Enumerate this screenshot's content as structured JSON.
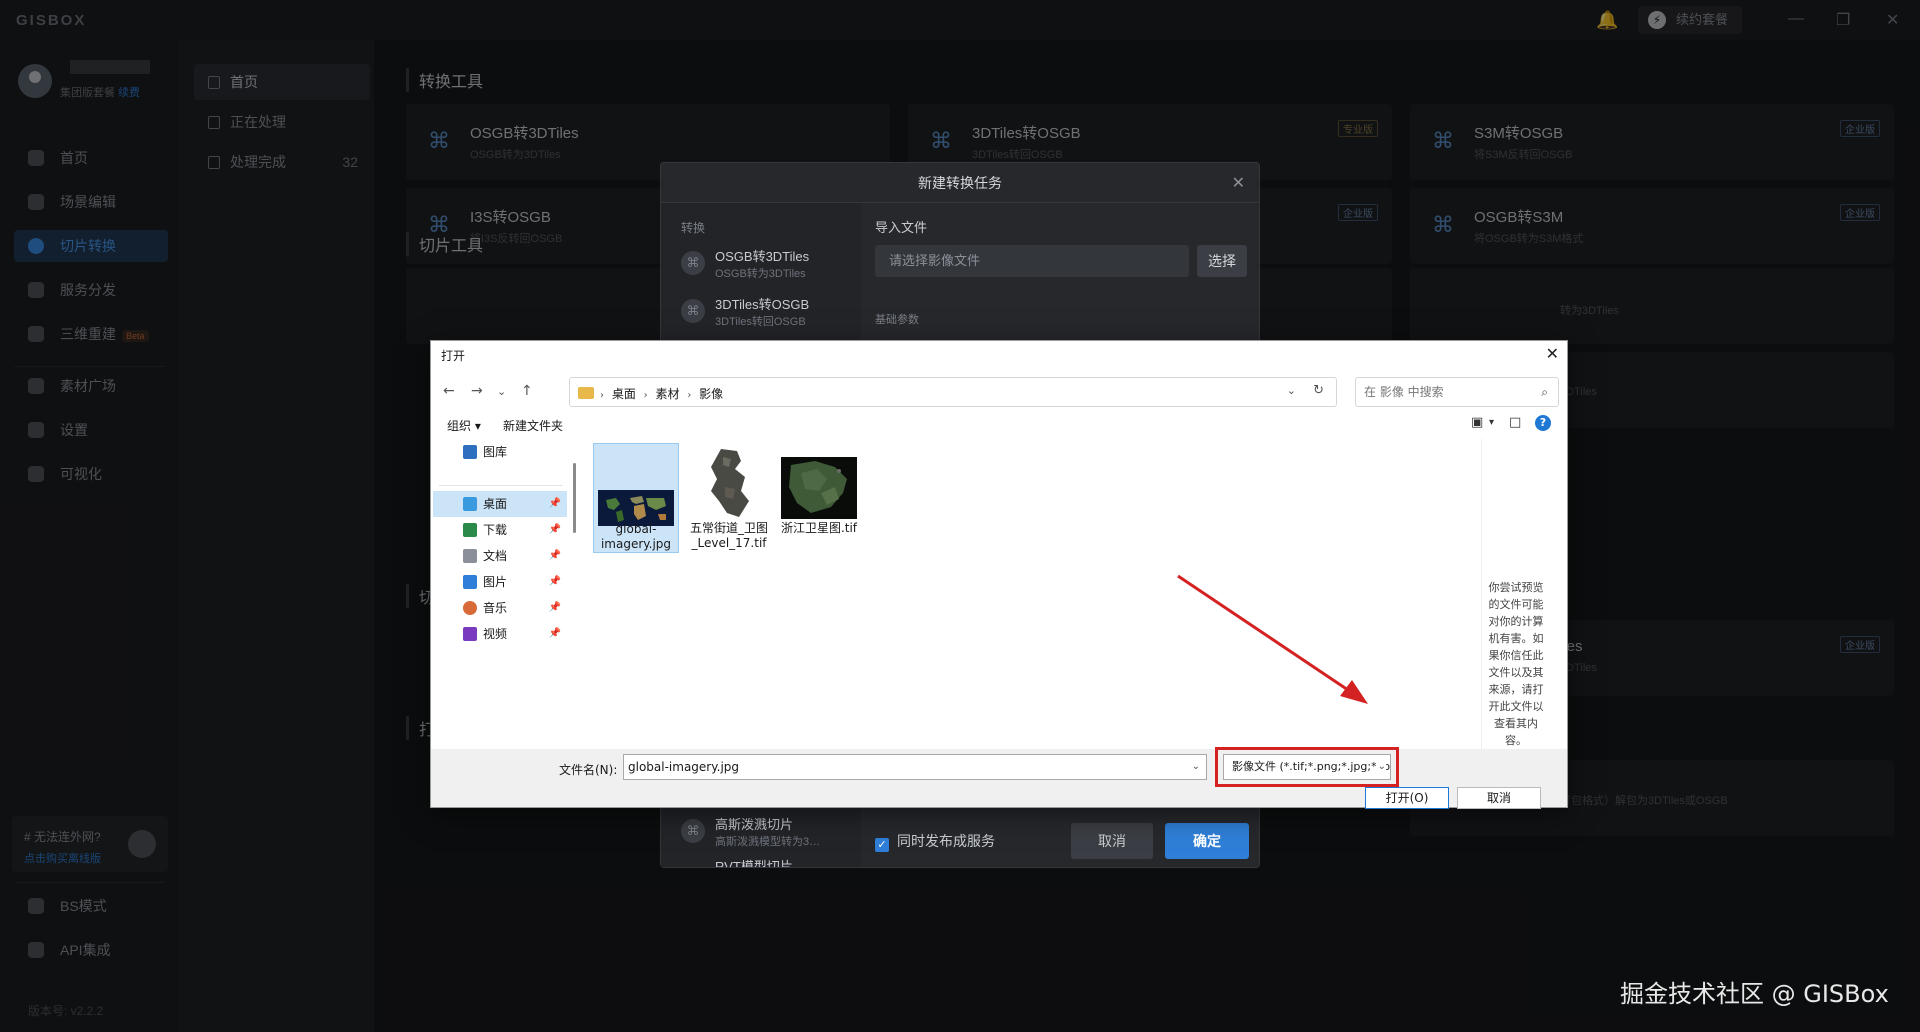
{
  "app": {
    "logo": "GISBOX",
    "renew": "续约套餐",
    "user": {
      "plan": "集团版套餐",
      "plan_action": "续费"
    },
    "sidebar": [
      {
        "label": "首页",
        "active": false
      },
      {
        "label": "场景编辑",
        "active": false
      },
      {
        "label": "切片转换",
        "active": true
      },
      {
        "label": "服务分发",
        "active": false
      },
      {
        "label": "三维重建",
        "badge": "Beta",
        "active": false
      },
      {
        "label": "素材广场",
        "active": false
      },
      {
        "label": "设置",
        "active": false
      },
      {
        "label": "可视化",
        "active": false
      }
    ],
    "promo": {
      "title": "# 无法连外网?",
      "link": "点击购买离线版"
    },
    "bottom_nav": [
      {
        "label": "BS模式"
      },
      {
        "label": "API集成"
      }
    ],
    "version": "版本号: v2.2.2",
    "subnav": [
      {
        "label": "首页",
        "active": true
      },
      {
        "label": "正在处理"
      },
      {
        "label": "处理完成",
        "count": "32"
      }
    ],
    "sections": {
      "convert": "转换工具",
      "slice": "切片工具",
      "slice_short": "切",
      "pack_short": "打"
    },
    "tools": [
      {
        "name": "OSGB转3DTiles",
        "desc": "OSGB转为3DTiles",
        "badge": ""
      },
      {
        "name": "3DTiles转OSGB",
        "desc": "3DTiles转回OSGB",
        "badge": "专业版"
      },
      {
        "name": "S3M转OSGB",
        "desc": "将S3M反转回OSGB",
        "badge": "企业版"
      },
      {
        "name": "I3S转OSGB",
        "desc": "将I3S反转回OSGB",
        "badge": ""
      },
      {
        "name": "OSGB转S3M",
        "desc": "将OSGB转为S3M格式",
        "badge": "企业版"
      }
    ],
    "bg_fragments": {
      "frag1": "转为3DTiles",
      "frag2": "3DTiles",
      "frag3": "iles",
      "frag4": "3DTiles",
      "frag5": "打包格式）解包为3DTiles或OSGB",
      "badge_enterprise": "企业版",
      "badge_pro": "专业版"
    }
  },
  "task_modal": {
    "title": "新建转换任务",
    "category": "转换",
    "items": [
      {
        "name": "OSGB转3DTiles",
        "desc": "OSGB转为3DTiles"
      },
      {
        "name": "3DTiles转OSGB",
        "desc": "3DTiles转回OSGB"
      },
      {
        "name": "高斯泼溅切片",
        "desc": "高斯泼溅模型转为3…"
      },
      {
        "name": "RVT模型切片",
        "desc": ""
      }
    ],
    "import_label": "导入文件",
    "import_placeholder": "请选择影像文件",
    "pick_button": "选择",
    "basic_params": "基础参数",
    "publish_check": "同时发布成服务",
    "cancel": "取消",
    "ok": "确定"
  },
  "file_dialog": {
    "title": "打开",
    "breadcrumbs": [
      "桌面",
      "素材",
      "影像"
    ],
    "search_placeholder": "在 影像 中搜索",
    "organize": "组织 ▾",
    "new_folder": "新建文件夹",
    "tree": [
      {
        "label": "图库",
        "color": "#2f6fc0",
        "pinned": false,
        "selected": false
      },
      {
        "label": "桌面",
        "color": "#3a9ae0",
        "pinned": true,
        "selected": true
      },
      {
        "label": "下载",
        "color": "#2a8a4a",
        "pinned": true,
        "selected": false
      },
      {
        "label": "文档",
        "color": "#8a8f99",
        "pinned": true,
        "selected": false
      },
      {
        "label": "图片",
        "color": "#2f7fd8",
        "pinned": true,
        "selected": false
      },
      {
        "label": "音乐",
        "color": "#d86a3a",
        "pinned": true,
        "selected": false
      },
      {
        "label": "视频",
        "color": "#7a3ac0",
        "pinned": true,
        "selected": false
      }
    ],
    "files": [
      {
        "name": "global-imagery.jpg",
        "selected": true
      },
      {
        "name": "五常街道_卫图_Level_17.tif",
        "selected": false
      },
      {
        "name": "浙江卫星图.tif",
        "selected": false
      }
    ],
    "preview_text": "你尝试预览的文件可能对你的计算机有害。如果你信任此文件以及其来源，请打开此文件以查看其内容。",
    "filename_label": "文件名(N):",
    "filename_value": "global-imagery.jpg",
    "filter": "影像文件 (*.tif;*.png;*.jpg;*.jpeg)",
    "open_button": "打开(O)",
    "cancel_button": "取消"
  },
  "watermark": "掘金技术社区 @ GISBox"
}
